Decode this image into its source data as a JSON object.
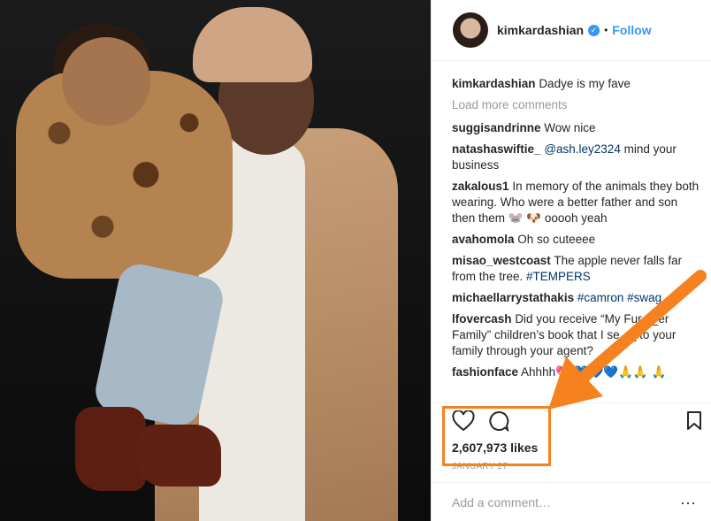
{
  "post": {
    "username": "kimkardashian",
    "follow_label": "Follow",
    "dot": "•",
    "verified_glyph": "✓"
  },
  "comments": [
    {
      "user": "kimkardashian",
      "text": "Dadye is my fave"
    },
    {
      "user": "suggisandrinne",
      "text": "Wow nice"
    },
    {
      "user": "natashaswiftie_",
      "mention": "@ash.ley2324",
      "text": " mind your business"
    },
    {
      "user": "zakalous1",
      "text": "In memory of the animals they both wearing. Who were a better father and son then them 🐭 🐶 ooooh yeah"
    },
    {
      "user": "avahomola",
      "text": "Oh so cuteeee"
    },
    {
      "user": "misao_westcoast",
      "text": "The apple never falls far from the tree. ",
      "tag": "#TEMPERS"
    },
    {
      "user": "michaellarrystathakis",
      "tag1": "#camron",
      "tag2": "#swag"
    },
    {
      "user": "lfovercash",
      "text": "Did you receive “My Fur_ _er Family” children’s book that I se_ _ to your family through your agent?"
    },
    {
      "user": "fashionface",
      "text": "Ahhhh💖 💙💙💙🙏🙏 🙏"
    }
  ],
  "load_more": "Load more comments",
  "likes": "2,607,973 likes",
  "date": "JANUARY 27",
  "add_comment_placeholder": "Add a comment…",
  "more_glyph": "···",
  "colors": {
    "accent": "#3897f0",
    "annotation": "#f5821f"
  },
  "icons": {
    "heart": "heart-icon",
    "comment": "comment-icon",
    "bookmark": "bookmark-icon",
    "more": "more-icon"
  }
}
